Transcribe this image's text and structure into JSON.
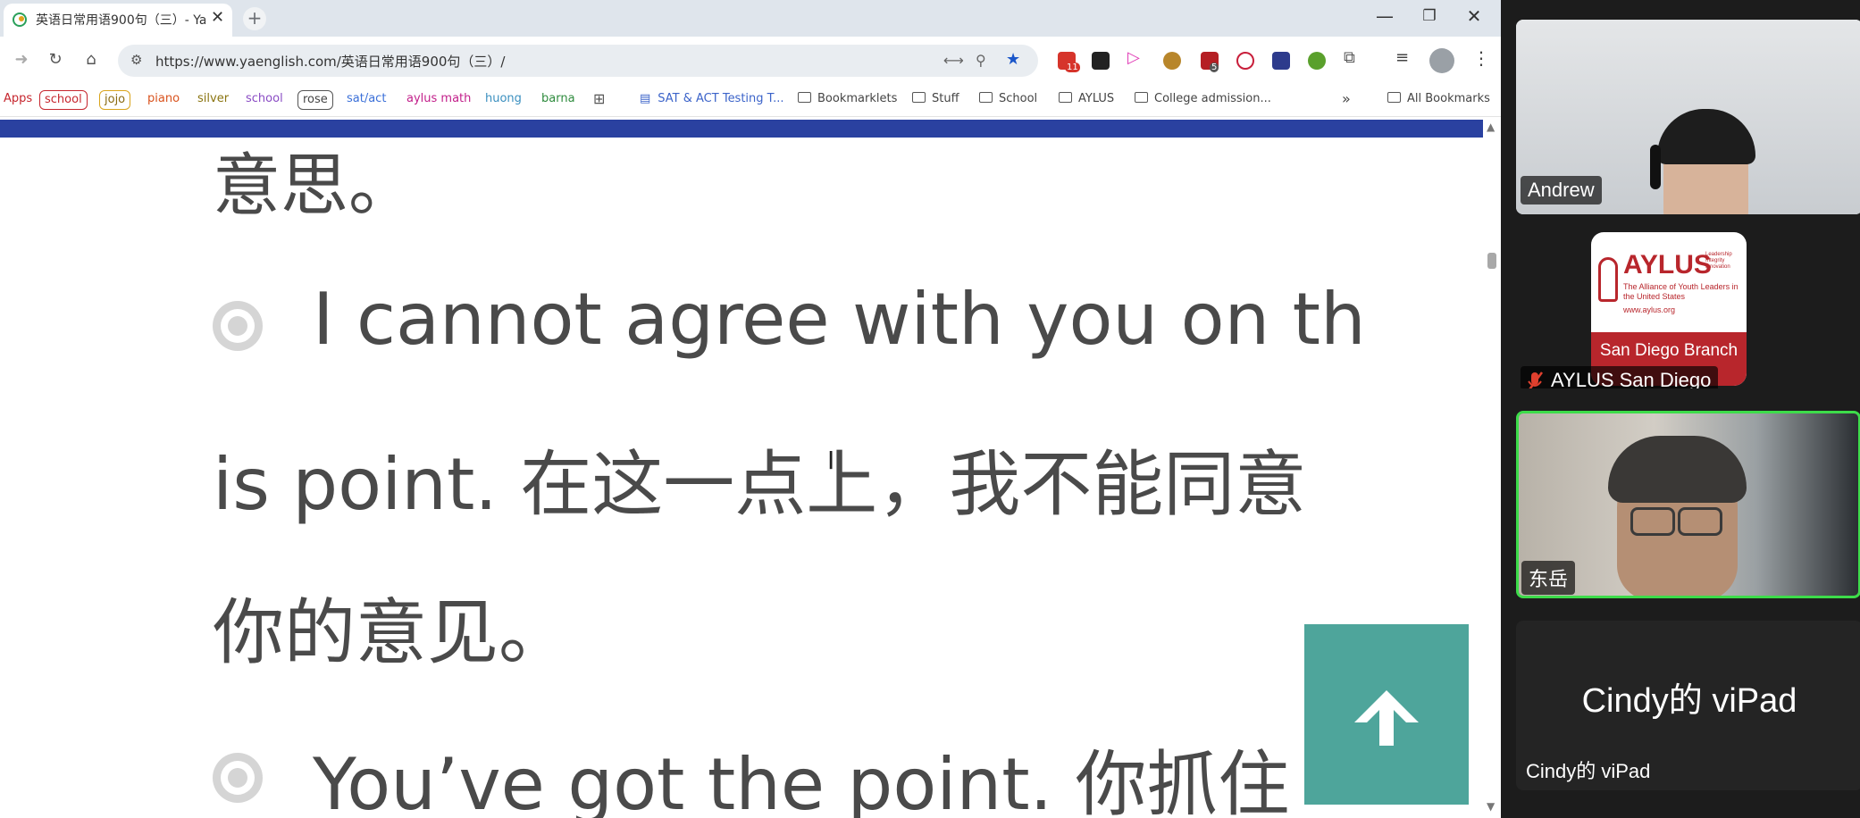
{
  "browser": {
    "tab_title": "英语日常用语900句（三）- Ya",
    "url": "https://www.yaenglish.com/英语日常用语900句（三）/",
    "window_controls": {
      "minimize": "—",
      "restore": "❐",
      "close": "✕"
    },
    "extension_badges": {
      "mail_count": "11",
      "ext_count": "5"
    }
  },
  "bookmarks": {
    "apps_label": "Apps",
    "chips": [
      {
        "label": "school",
        "color": "#c6262e"
      },
      {
        "label": "jojo",
        "color": "#d9a41b"
      },
      {
        "label": "piano",
        "color": "#d9531e"
      },
      {
        "label": "silver",
        "color": "#c9a227"
      },
      {
        "label": "school",
        "color": "#8a4cc4"
      },
      {
        "label": "rose",
        "color": "#555555"
      },
      {
        "label": "sat/act",
        "color": "#3a6fd8"
      },
      {
        "label": "aylus math",
        "color": "#c21f8a"
      },
      {
        "label": "huong",
        "color": "#3a8fbf"
      },
      {
        "label": "barna",
        "color": "#2e8b3d"
      }
    ],
    "doc_link": "SAT & ACT Testing T...",
    "folders": [
      "Bookmarklets",
      "Stuff",
      "School",
      "AYLUS",
      "College admission..."
    ],
    "more": "»",
    "all_bookmarks": "All Bookmarks"
  },
  "content": {
    "line1": "意思。",
    "line2": "I cannot agree with you on th",
    "line3": "is point. 在这一点上，我不能同意",
    "line4": "你的意见。",
    "line5": "You’ve got the point. 你抓住"
  },
  "meeting": {
    "participants": [
      {
        "name": "Andrew"
      },
      {
        "name": "AYLUS San Diego",
        "muted": true,
        "logo_title": "AYLUS",
        "logo_tagline": "The Alliance of Youth Leaders in the United States",
        "logo_url": "www.aylus.org",
        "logo_branch": "San Diego Branch",
        "logo_motto": "Leadership Integrity Innovation"
      },
      {
        "name": "东岳",
        "active_speaker": true
      },
      {
        "name": "Cindy的 viPad",
        "display_center": "Cindy的 viPad"
      }
    ]
  }
}
